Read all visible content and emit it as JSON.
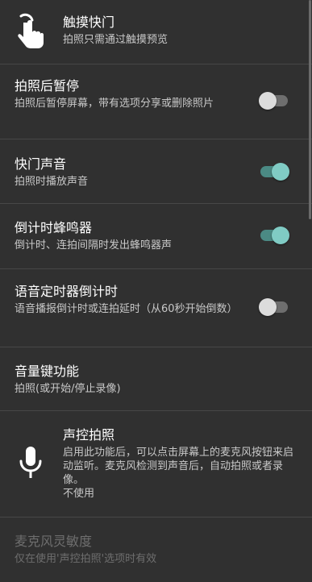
{
  "settings": {
    "touch_shutter": {
      "title": "触摸快门",
      "summary": "拍照只需通过触摸预览",
      "icon": "touch-hand-icon"
    },
    "pause_after_capture": {
      "title": "拍照后暂停",
      "summary": "拍照后暂停屏幕，带有选项分享或删除照片",
      "enabled": false
    },
    "shutter_sound": {
      "title": "快门声音",
      "summary": "拍照时播放声音",
      "enabled": true
    },
    "countdown_beep": {
      "title": "倒计时蜂鸣器",
      "summary": "倒计时、连拍间隔时发出蜂鸣器声",
      "enabled": true
    },
    "voice_countdown": {
      "title": "语音定时器倒计时",
      "summary": "语音播报倒计时或连拍延时（从60秒开始倒数）",
      "enabled": false
    },
    "volume_keys": {
      "title": "音量键功能",
      "summary": "拍照(或开始/停止录像)"
    },
    "voice_control": {
      "title": "声控拍照",
      "summary": "启用此功能后，可以点击屏幕上的麦克风按钮来启动监听。麦克风检测到声音后，自动拍照或者录像。",
      "value": "不使用",
      "icon": "microphone-icon"
    },
    "mic_sensitivity": {
      "title": "麦克风灵敏度",
      "summary": "仅在使用'声控拍照'选项时有效"
    }
  },
  "colors": {
    "background": "#303030",
    "accent": "#80cbc4",
    "divider": "#474747"
  }
}
